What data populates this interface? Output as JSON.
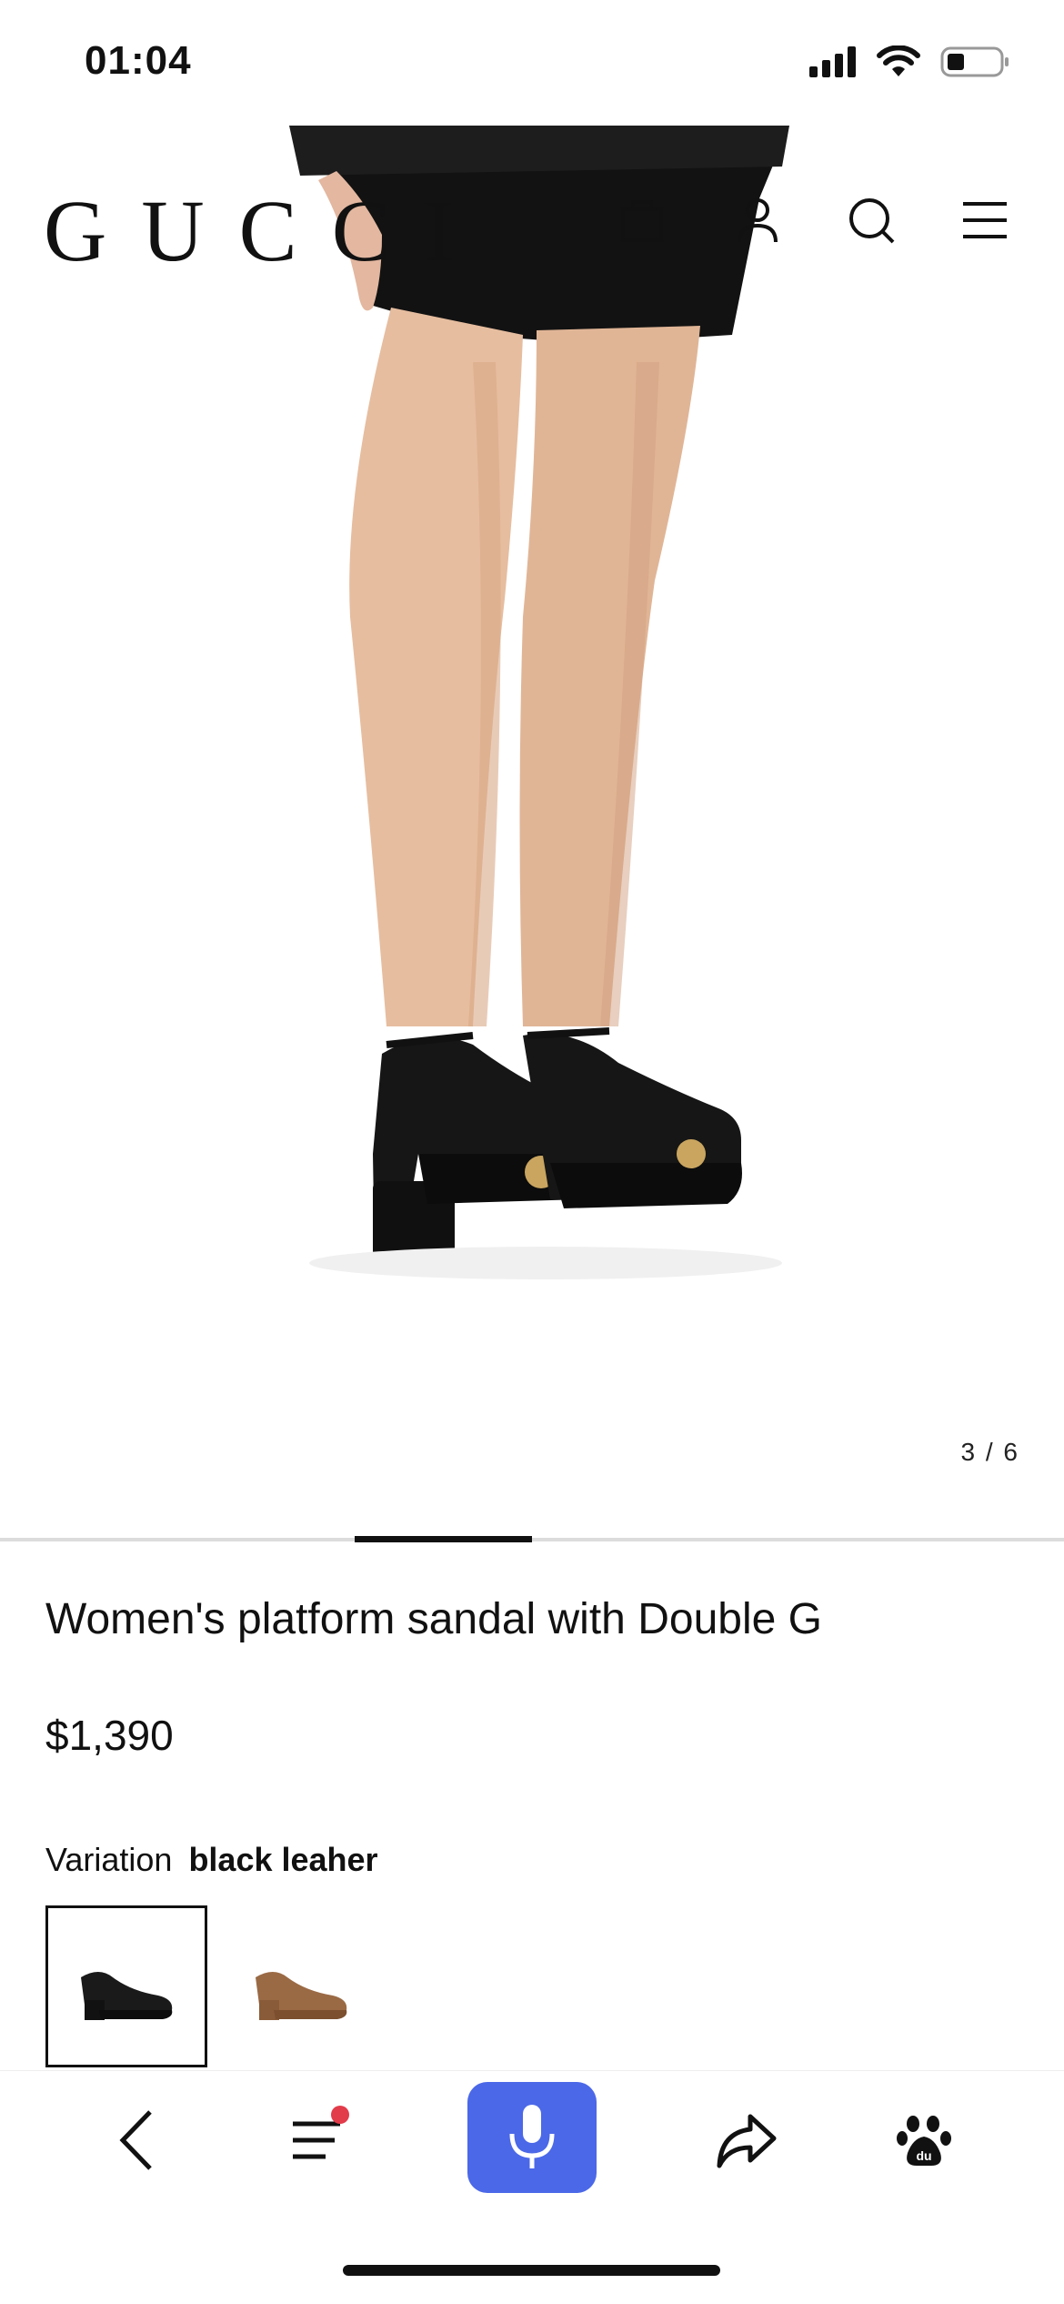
{
  "status_bar": {
    "time": "01:04"
  },
  "header": {
    "logo": "GUCCI"
  },
  "gallery": {
    "counter": "3 / 6",
    "current": 3,
    "total": 6
  },
  "product": {
    "title": "Women's platform sandal with Double G",
    "price": "$1,390",
    "variation_label": "Variation",
    "variation_value": "black leaher",
    "swatches": [
      {
        "name": "black leather",
        "selected": true
      },
      {
        "name": "brown leather",
        "selected": false
      }
    ]
  },
  "toolbar": {
    "items": [
      "back-icon",
      "list-icon",
      "microphone-icon",
      "share-icon",
      "paw-icon"
    ],
    "notification_dot": true,
    "accent": "#4b68e8"
  }
}
